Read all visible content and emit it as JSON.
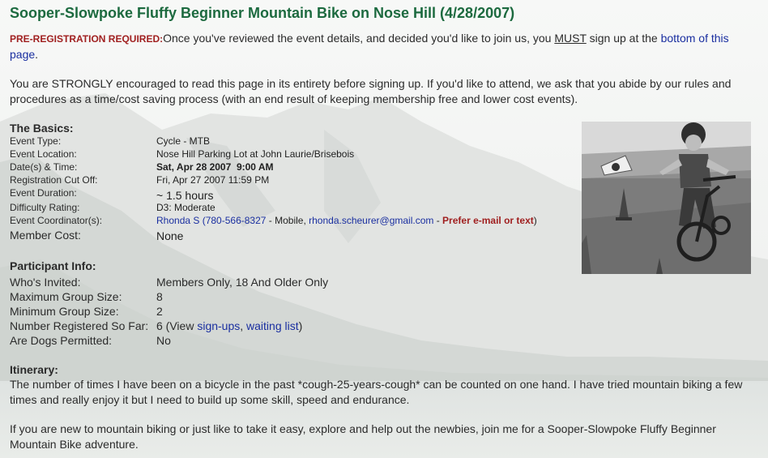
{
  "title": "Sooper-Slowpoke Fluffy Beginner Mountain Bike on Nose Hill (4/28/2007)",
  "prereg": {
    "label": "PRE-REGISTRATION REQUIRED:",
    "text1": "Once you've reviewed the event details, and decided you'd like to join us, you ",
    "must": "MUST",
    "text2": " sign up at the ",
    "link": "bottom of this page",
    "end": "."
  },
  "encourage": "You are STRONGLY encouraged to read this page in its entirety before signing up. If you'd like to attend, we ask that you abide by our rules and procedures as a time/cost saving process (with an end result of keeping membership free and lower cost events).",
  "basics": {
    "heading": "The Basics:",
    "rows": [
      {
        "label": "Event Type:",
        "value": "Cycle - MTB"
      },
      {
        "label": "Event Location:",
        "value": "Nose Hill Parking Lot at John Laurie/Brisebois"
      },
      {
        "label": "Date(s) & Time:",
        "value": "Sat, Apr 28 2007  9:00 AM"
      },
      {
        "label": "Registration Cut Off:",
        "value": "Fri, Apr 27 2007 11:59 PM"
      },
      {
        "label": "Event Duration:",
        "value": "~ 1.5 hours"
      },
      {
        "label": "Difficulty Rating:",
        "value": "D3: Moderate"
      },
      {
        "label": "Event Coordinator(s):",
        "value": ""
      },
      {
        "label": "Member Cost:",
        "value": "None"
      }
    ],
    "coordinator": {
      "name_phone": "Rhonda S (780-566-8327",
      "mobile": " - Mobile, ",
      "email": "rhonda.scheurer@gmail.com",
      "dash": " - ",
      "prefer": "Prefer e-mail or text",
      "close": ")"
    }
  },
  "participant": {
    "heading": "Participant Info:",
    "rows": [
      {
        "label": "Who's Invited:",
        "value": "Members Only, 18 And Older Only"
      },
      {
        "label": "Maximum Group Size:",
        "value": "8"
      },
      {
        "label": "Minimum Group Size:",
        "value": "2"
      },
      {
        "label": "Number Registered So Far:",
        "value": ""
      },
      {
        "label": "Are Dogs Permitted:",
        "value": "No"
      }
    ],
    "registered": {
      "count": "6 (View ",
      "signups": "sign-ups",
      "comma": ", ",
      "waiting": "waiting list",
      "close": ")"
    }
  },
  "itinerary": {
    "heading": "Itinerary:",
    "p1": "The number of times I have been on a bicycle in the past *cough-25-years-cough* can be counted on one hand. I have tried mountain biking a few times and really enjoy it but I need to build up some skill, speed and endurance.",
    "p2": "If you are new to mountain biking or just like to take it easy, explore and help out the newbies, join me for a Sooper-Slowpoke Fluffy Beginner Mountain Bike adventure."
  },
  "colors": {
    "title": "#1c6a3f",
    "alert": "#a02020",
    "link": "#1a2fa0"
  }
}
